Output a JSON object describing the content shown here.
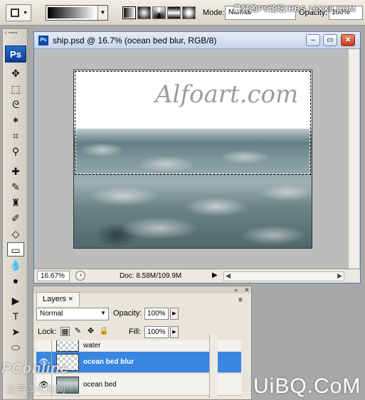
{
  "options_bar": {
    "mode_label": "Mode:",
    "mode_value": "Normal",
    "opacity_label": "Opacity:",
    "opacity_value": "100%"
  },
  "toolbox": {
    "logo": "Ps",
    "tools": [
      "move-tool",
      "marquee-tool",
      "lasso-tool",
      "magic-wand-tool",
      "crop-tool",
      "eyedropper-tool",
      "healing-brush-tool",
      "brush-tool",
      "clone-stamp-tool",
      "history-brush-tool",
      "eraser-tool",
      "gradient-tool",
      "blur-tool",
      "dodge-tool",
      "path-selection-tool",
      "type-tool",
      "direct-selection-tool",
      "ellipse-tool"
    ],
    "selected": "gradient-tool"
  },
  "document": {
    "title": "ship.psd @ 16.7% (ocean bed blur, RGB/8)",
    "canvas_text": "Alfoart.com",
    "zoom": "16.67%",
    "doc_info": "Doc: 8.58M/109.9M"
  },
  "layers_panel": {
    "tab_label": "Layers",
    "blend_mode": "Normal",
    "opacity_label": "Opacity:",
    "opacity_value": "100%",
    "lock_label": "Lock:",
    "fill_label": "Fill:",
    "fill_value": "100%",
    "layers": [
      {
        "name": "water",
        "visible": false,
        "selected": false
      },
      {
        "name": "ocean bed blur",
        "visible": true,
        "selected": true
      },
      {
        "name": "ocean bed",
        "visible": true,
        "selected": false
      }
    ]
  },
  "watermarks": {
    "top": "最好的PS论坛:BBS.16XX8.COM",
    "pconline": "PConline",
    "pconline_sub": "太平洋电脑网",
    "uibq": "UiBQ.CoM"
  },
  "colors": {
    "selection_blue": "#3a86e0",
    "ps_logo": "#0b3d96"
  }
}
